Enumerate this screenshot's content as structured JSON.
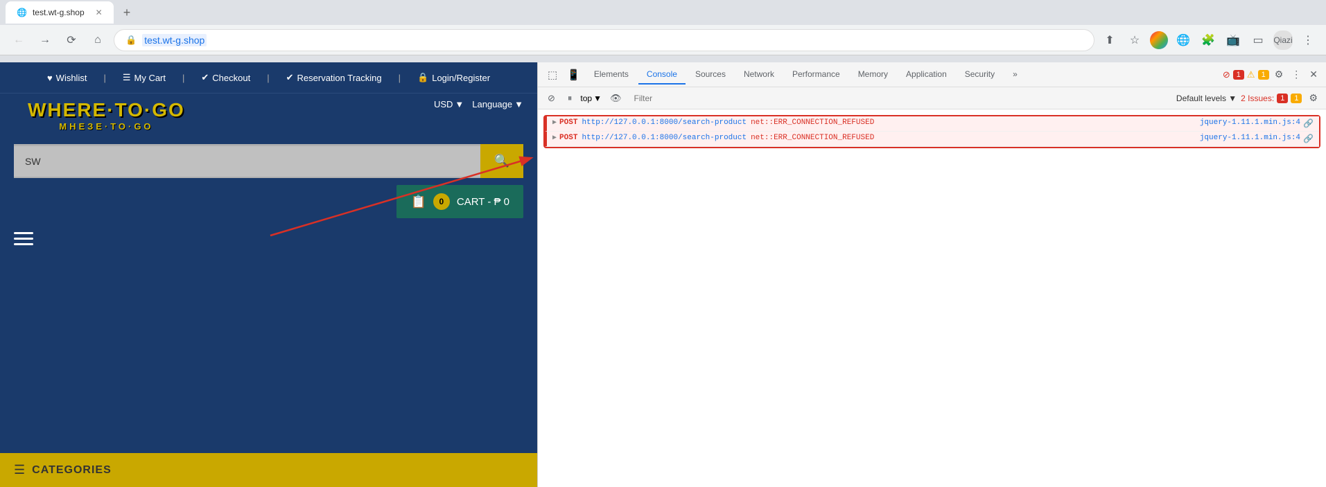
{
  "browser": {
    "url": "test.wt-g.shop",
    "url_display": "test.wt-g.shop"
  },
  "devtools": {
    "tabs": [
      "Elements",
      "Console",
      "Sources",
      "Network",
      "Performance",
      "Memory",
      "Application",
      "Security"
    ],
    "active_tab": "Console",
    "more_label": "»",
    "filter_placeholder": "Filter",
    "top_select": "top",
    "default_levels": "Default levels ▼",
    "issues_label": "2 Issues:",
    "badge_red": "1",
    "badge_yellow": "1",
    "console_rows": [
      {
        "method": "▶ POST",
        "url": "http://127.0.0.1:8000/search-product",
        "error": "net::ERR_CONNECTION_REFUSED",
        "source": "jquery-1.11.1.min.js:4",
        "highlighted": true
      },
      {
        "method": "▶ POST",
        "url": "http://127.0.0.1:8000/search-product",
        "error": "net::ERR_CONNECTION_REFUSED",
        "source": "jquery-1.11.1.min.js:4",
        "highlighted": true
      }
    ]
  },
  "website": {
    "nav_items": [
      {
        "icon": "♥",
        "label": "Wishlist"
      },
      {
        "icon": "☰",
        "label": "My Cart"
      },
      {
        "icon": "✔",
        "label": "Checkout"
      },
      {
        "icon": "✔",
        "label": "Reservation Tracking"
      },
      {
        "icon": "🔒",
        "label": "Login/Register"
      }
    ],
    "logo_main": "WHERE·TO·GO",
    "logo_sub": "МНЕЗЕ·ТО·GO",
    "currency": "USD",
    "language": "Language",
    "search_value": "SW",
    "search_placeholder": "SW",
    "cart_label": "CART - ₱ 0",
    "cart_count": "0",
    "categories_label": "CATEGORIES"
  }
}
